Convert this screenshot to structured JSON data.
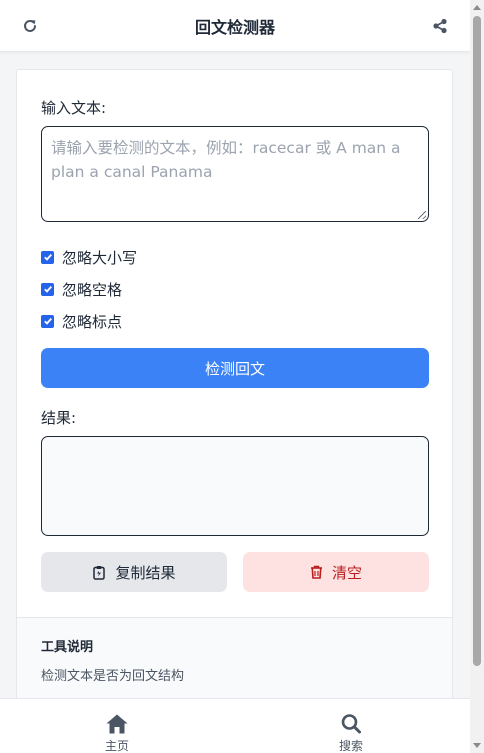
{
  "header": {
    "title": "回文检测器",
    "left_icon": "refresh-icon",
    "right_icon": "share-icon"
  },
  "form": {
    "input_label": "输入文本:",
    "input_placeholder": "请输入要检测的文本，例如：racecar 或 A man a plan a canal Panama",
    "input_value": "",
    "options": [
      {
        "label": "忽略大小写",
        "checked": true
      },
      {
        "label": "忽略空格",
        "checked": true
      },
      {
        "label": "忽略标点",
        "checked": true
      }
    ],
    "detect_button": "检测回文",
    "result_label": "结果:",
    "result_value": "",
    "copy_button": "复制结果",
    "clear_button": "清空"
  },
  "info": {
    "heading": "工具说明",
    "description": "检测文本是否为回文结构"
  },
  "nav": {
    "items": [
      {
        "label": "主页",
        "icon": "home-icon"
      },
      {
        "label": "搜索",
        "icon": "search-icon"
      }
    ]
  },
  "colors": {
    "primary": "#3b82f6",
    "danger_bg": "#fee2e2",
    "danger_text": "#b91c1c",
    "neutral_button": "#e5e7eb",
    "checkbox": "#2563eb"
  }
}
